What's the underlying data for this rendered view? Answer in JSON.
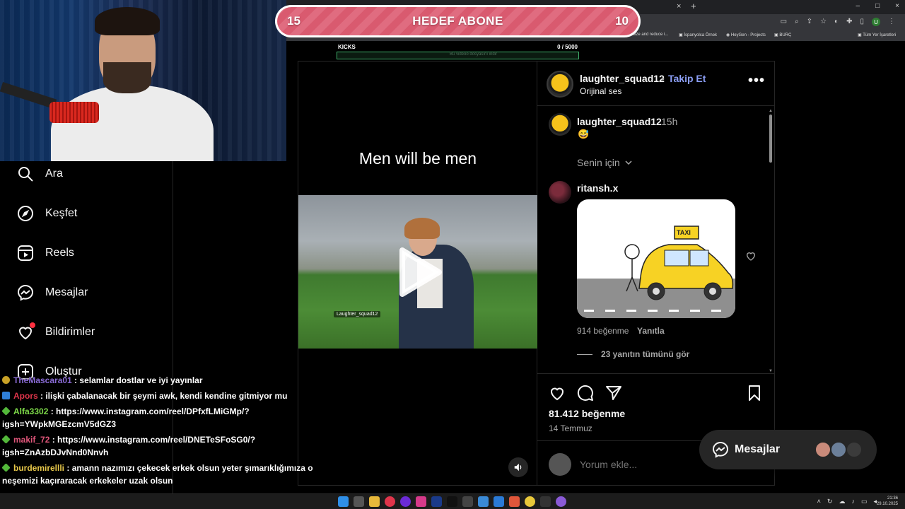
{
  "browser": {
    "tab_close": "×",
    "tab_new": "+",
    "window_controls": [
      "–",
      "□",
      "×"
    ],
    "profile_initial": "U",
    "bookmarks": [
      {
        "label": "size and reduce i..."
      },
      {
        "label": "İspanyolca Örnek"
      },
      {
        "label": "HeyGen - Projects"
      },
      {
        "label": "BURÇ"
      },
      {
        "label": "Tüm Yer İşaretleri"
      }
    ]
  },
  "sub_goal": {
    "left_value": "15",
    "title": "HEDEF ABONE",
    "right_value": "10"
  },
  "kicks": {
    "label": "KICKS",
    "count": "0   / 5000",
    "progress_fraction": 0.0,
    "ghost_text": "Bu videoo dosyasını indir"
  },
  "sidebar": {
    "items": [
      {
        "label": "Ara",
        "icon": "search-icon"
      },
      {
        "label": "Keşfet",
        "icon": "compass-icon"
      },
      {
        "label": "Reels",
        "icon": "reels-icon"
      },
      {
        "label": "Mesajlar",
        "icon": "messenger-icon"
      },
      {
        "label": "Bildirimler",
        "icon": "heart-icon"
      },
      {
        "label": "Oluştur",
        "icon": "plus-square-icon"
      }
    ]
  },
  "post": {
    "video_caption": "Men will be men",
    "video_watermark": "Laughter_squad12",
    "header": {
      "username": "laughter_squad12",
      "separator": "•",
      "follow_label": "Takip Et",
      "audio_label": "Orijinal ses",
      "more_label": "•••"
    },
    "caption_comment": {
      "username": "laughter_squad12",
      "time": "15h",
      "text": "😅"
    },
    "sort_label": "Senin için",
    "comment": {
      "username": "ritansh.x",
      "gif_sign": "TAXI",
      "likes": "914 beğenme",
      "reply_label": "Yanıtla",
      "view_replies": "23 yanıtın tümünü gör"
    },
    "likes": "81.412 beğenme",
    "date": "14 Temmuz",
    "comment_placeholder": "Yorum ekle..."
  },
  "messages_pill": {
    "label": "Mesajlar"
  },
  "chat": [
    {
      "user": "TheMascara01",
      "sep": " : ",
      "text": "selamlar dostlar ve iyi yayınlar",
      "badge_color": "#c9a227"
    },
    {
      "user": "Apors",
      "sep": " : ",
      "text": "ilişki çabalanacak bir şeymi awk, kendi kendine gitmiyor mu",
      "badge_color": "#2f7fd8"
    },
    {
      "user": "Alfa3302",
      "sep": " : ",
      "text": "https://www.instagram.com/reel/DPfxfLMiGMp/?",
      "text2": "igsh=YWpkMGEzcmV5dGZ3",
      "badge_color": "#53b83a"
    },
    {
      "user": "makif_72",
      "sep": " : ",
      "text": "https://www.instagram.com/reel/DNETeSFoSG0/?",
      "text2": "igsh=ZnAzbDJvNnd0Nnvh",
      "badge_color": "#53b83a"
    },
    {
      "user": "burdemirellli",
      "sep": " : ",
      "text": "amann nazımızı çekecek erkek olsun yeter şımarıklığımıza o",
      "text2": "neşemizi kaçıraracak erkekeler uzak olsun",
      "badge_color": "#53b83a"
    }
  ],
  "taskbar": {
    "time": "21:36",
    "date": "29.10.2025"
  }
}
